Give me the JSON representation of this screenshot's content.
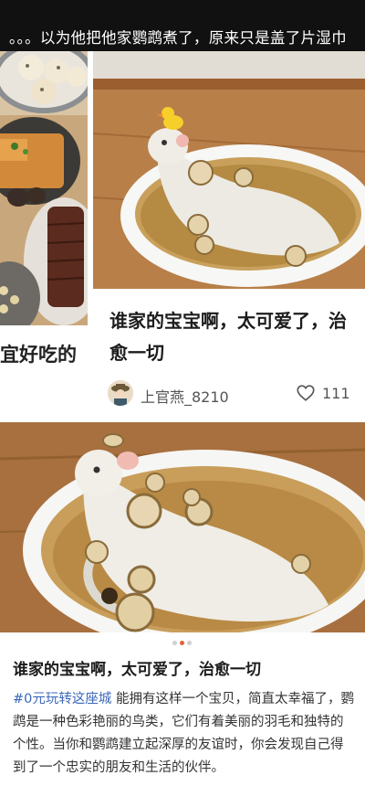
{
  "banner": {
    "text": "。。。以为他把他家鹦鹉煮了，原来只是盖了片湿巾"
  },
  "left_card": {
    "title": "宜好吃的"
  },
  "right_card": {
    "title": "谁家的宝宝啊，太可爱了，治愈一切",
    "author": "上官燕_8210",
    "likes": "111"
  },
  "post": {
    "title": "谁家的宝宝啊，太可爱了，治愈一切",
    "topic": "#0元玩转这座城",
    "body": " 能拥有这样一个宝贝，简直太幸福了，鹦鹉是一种色彩艳丽的鸟类，它们有着美丽的羽毛和独特的个性。当你和鹦鹉建立起深厚的友谊时，你会发现自己得到了一个忠实的朋友和生活的伙伴。"
  },
  "carousel": {
    "count": 3,
    "active": 1
  },
  "colors": {
    "accent": "#e2623a",
    "link": "#3b67b8",
    "banner": "#111111"
  },
  "icons": {
    "like": "heart-outline-icon",
    "avatar": "user-avatar"
  }
}
